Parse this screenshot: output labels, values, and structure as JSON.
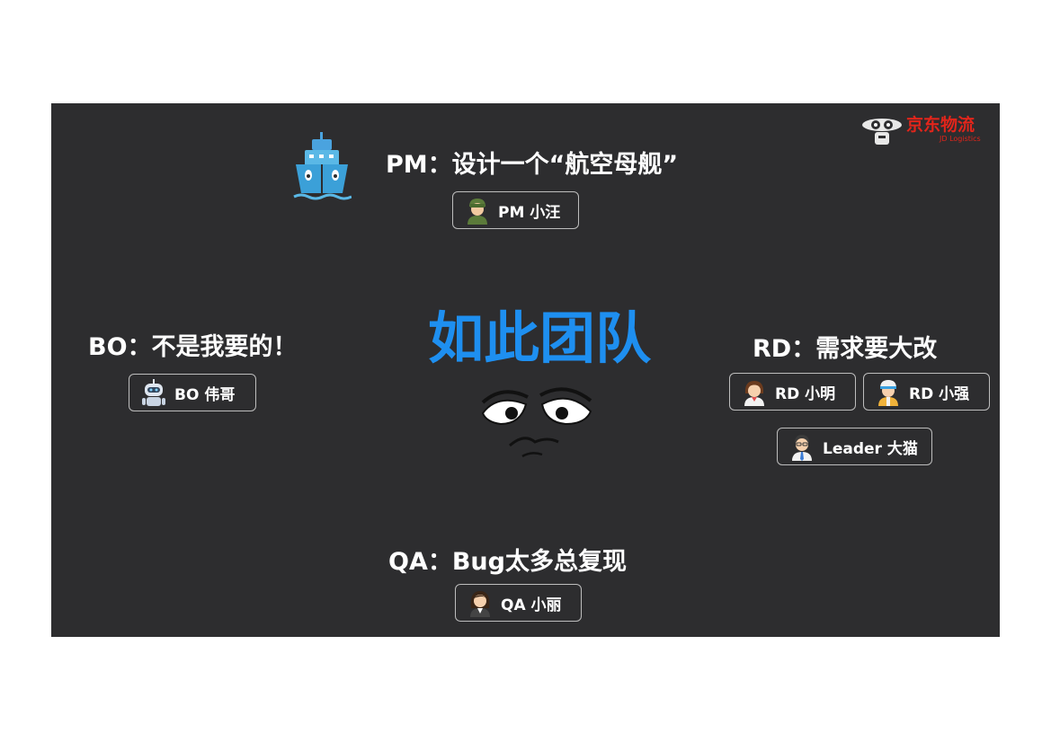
{
  "brand": {
    "name": "京东物流",
    "sub": "JD Logistics",
    "color": "#e1251b"
  },
  "title": "如此团队",
  "roles": {
    "pm": {
      "text": "PM：设计一个“航空母舰”",
      "members": [
        "PM 小汪"
      ]
    },
    "bo": {
      "text": "BO：不是我要的！",
      "members": [
        "BO 伟哥"
      ]
    },
    "rd": {
      "text": "RD：需求要大改",
      "members": [
        "RD 小明",
        "RD 小强",
        "Leader 大猫"
      ]
    },
    "qa": {
      "text": "QA：Bug太多总复现",
      "members": [
        "QA 小丽"
      ]
    }
  },
  "colors": {
    "background": "#2d2d2f",
    "title": "#1e8ff0",
    "text": "#ffffff",
    "border": "#bdbdbd"
  },
  "icons": [
    "aircraft-carrier-icon",
    "sad-face-icon",
    "robot-avatar-icon",
    "soldier-avatar-icon",
    "girl-avatar-icon",
    "worker-avatar-icon",
    "manager-avatar-icon",
    "woman-avatar-icon",
    "jd-logistics-logo-icon"
  ]
}
